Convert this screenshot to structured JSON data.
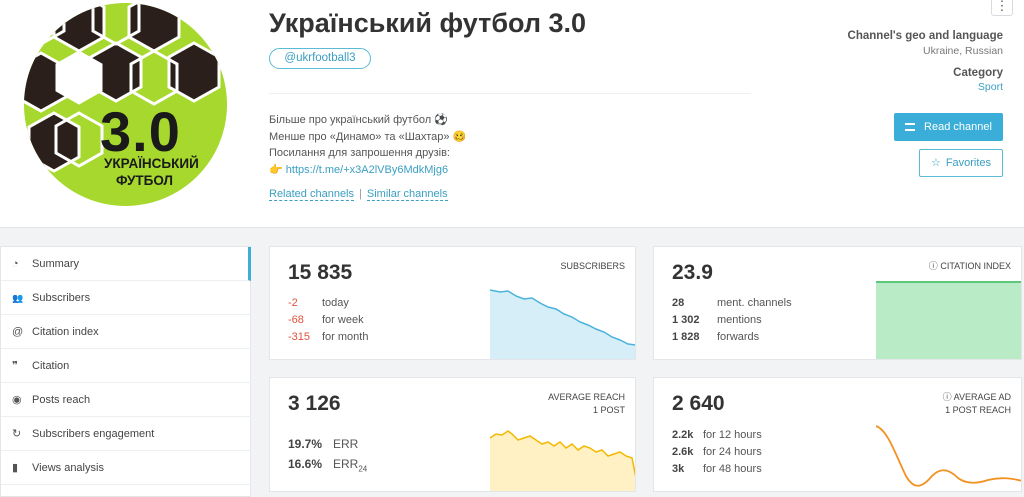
{
  "channel": {
    "title": "Український футбол 3.0",
    "handle": "@ukrfootball3",
    "logo_number": "3.0",
    "logo_line1": "УКРАЇНСЬКИЙ",
    "logo_line2": "ФУТБОЛ",
    "description": [
      "Більше про український футбол ⚽",
      "Менше про «Динамо» та «Шахтар» 🥴",
      "Посилання для запрошення друзів:"
    ],
    "invite_prefix": "👉",
    "invite_link": "https://t.me/+x3A2lVBy6MdkMjg6",
    "related_label": "Related channels",
    "similar_label": "Similar channels",
    "separator": "|"
  },
  "info": {
    "geo_heading": "Channel's geo and language",
    "geo_value": "Ukraine, Russian",
    "category_heading": "Category",
    "category_value": "Sport",
    "read_button": "Read channel",
    "fav_button": "Favorites",
    "menu_glyph": "⋮"
  },
  "sidebar": {
    "items": [
      {
        "label": "Summary",
        "icon": "summary-icon",
        "glyph": "◔"
      },
      {
        "label": "Subscribers",
        "icon": "users-icon",
        "glyph": "👥"
      },
      {
        "label": "Citation index",
        "icon": "at-icon",
        "glyph": "@"
      },
      {
        "label": "Citation",
        "icon": "quote-icon",
        "glyph": "❞"
      },
      {
        "label": "Posts reach",
        "icon": "eye-icon",
        "glyph": "◉"
      },
      {
        "label": "Subscribers engagement",
        "icon": "engagement-icon",
        "glyph": "↻"
      },
      {
        "label": "Views analysis",
        "icon": "bars-icon",
        "glyph": "▮"
      }
    ]
  },
  "cards": {
    "subscribers": {
      "value": "15 835",
      "label": "SUBSCRIBERS",
      "rows": [
        {
          "n": "-2",
          "l": "today"
        },
        {
          "n": "-68",
          "l": "for week"
        },
        {
          "n": "-315",
          "l": "for month"
        }
      ]
    },
    "citation": {
      "value": "23.9",
      "label": "CITATION INDEX",
      "info_glyph": "ⓘ",
      "rows": [
        {
          "n": "28",
          "l": "ment. channels"
        },
        {
          "n": "1 302",
          "l": "mentions"
        },
        {
          "n": "1 828",
          "l": "forwards"
        }
      ]
    },
    "reach": {
      "value": "3 126",
      "label1": "AVERAGE REACH",
      "label2": "1 POST",
      "rows": [
        {
          "n": "19.7%",
          "l": "ERR"
        },
        {
          "n": "16.6%",
          "l": "ERR",
          "sub": "24"
        }
      ]
    },
    "adreach": {
      "value": "2 640",
      "label1": "AVERAGE AD",
      "label2": "1 POST REACH",
      "info_glyph": "ⓘ",
      "rows": [
        {
          "n": "2.2k",
          "l": "for 12 hours"
        },
        {
          "n": "2.6k",
          "l": "for 24 hours"
        },
        {
          "n": "3k",
          "l": "for 48 hours"
        }
      ]
    }
  },
  "colors": {
    "accent": "#3aaed8",
    "logo_green": "#a6d82d",
    "negative": "#e0523e",
    "subs_line": "#4ab3d9",
    "subs_fill": "#d5eef8",
    "cit_line": "#5cc97a",
    "cit_fill": "#b8ebc6",
    "reach_line": "#f5b800",
    "reach_fill": "#fff1c4",
    "ad_line": "#f39224"
  }
}
